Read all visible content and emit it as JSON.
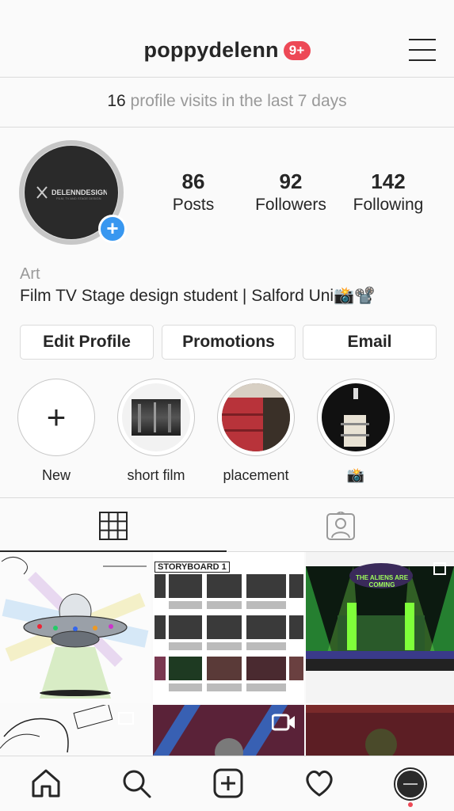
{
  "header": {
    "username": "poppydelenn",
    "notification_badge": "9+",
    "menu_icon": "hamburger-menu-icon"
  },
  "visits": {
    "count": "16",
    "text": "profile visits in the last 7 days"
  },
  "profile": {
    "avatar_logo_text": "DELENNDESIGN",
    "avatar_logo_subtext": "FILM, TV AND STAGE DESIGN",
    "stats": [
      {
        "value": "86",
        "label": "Posts"
      },
      {
        "value": "92",
        "label": "Followers"
      },
      {
        "value": "142",
        "label": "Following"
      }
    ],
    "category": "Art",
    "bio": "Film TV Stage design student | Salford Uni📸📽️"
  },
  "actions": {
    "edit_profile": "Edit Profile",
    "promotions": "Promotions",
    "email": "Email"
  },
  "highlights": [
    {
      "label": "New"
    },
    {
      "label": "short film"
    },
    {
      "label": "placement"
    },
    {
      "label": "📸"
    }
  ],
  "tabs": {
    "grid_icon": "grid-icon",
    "tagged_icon": "tagged-person-icon"
  },
  "posts": [
    {
      "kind": "ufo sketch"
    },
    {
      "kind": "storyboard",
      "caption": "STORYBOARD 1"
    },
    {
      "kind": "stage render",
      "caption": "THE ALIENS ARE COMING"
    },
    {
      "kind": "sketch"
    },
    {
      "kind": "video",
      "icon": "video-camera-icon"
    },
    {
      "kind": "render"
    }
  ],
  "colors": {
    "accent": "#3897f0",
    "badge": "#ed4956",
    "text": "#262626",
    "muted": "#999999"
  }
}
